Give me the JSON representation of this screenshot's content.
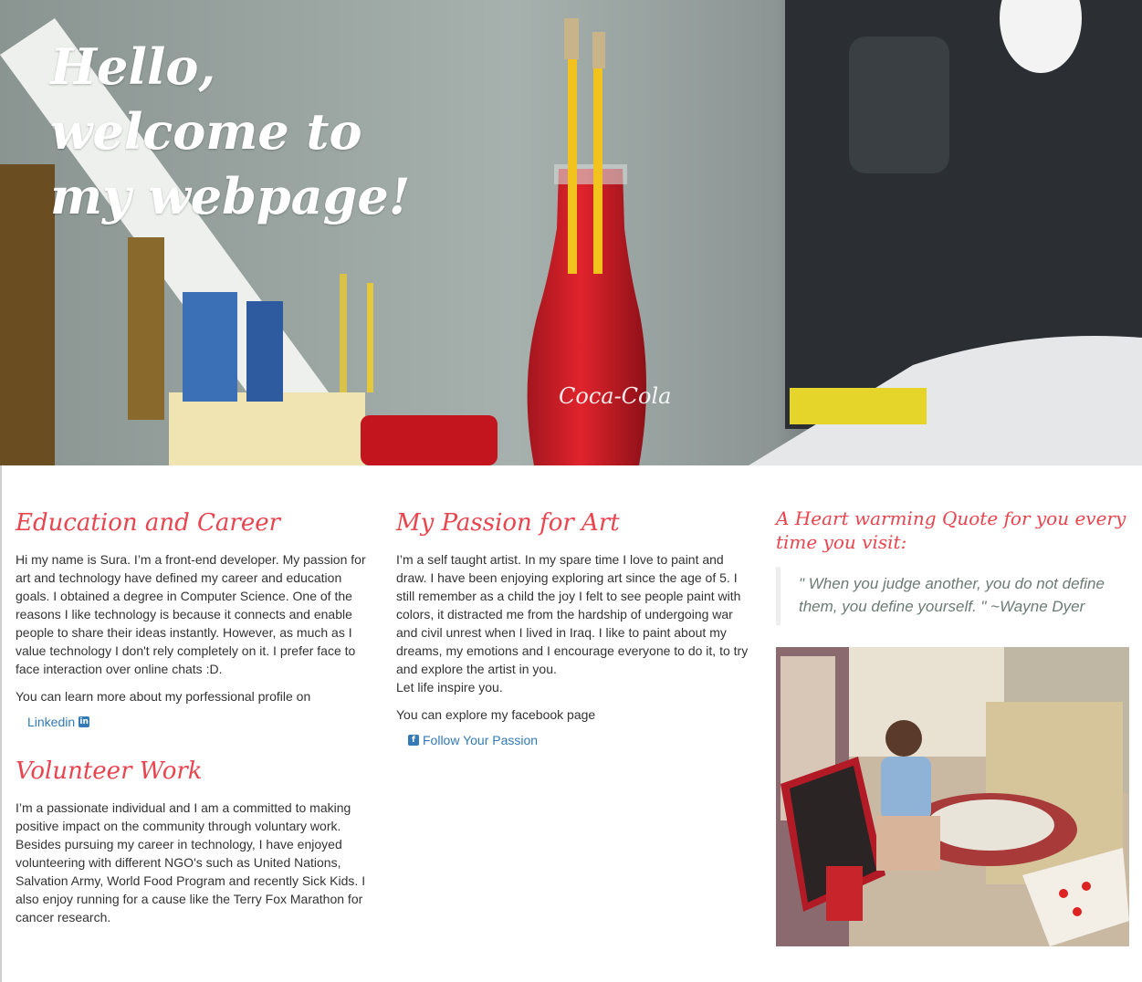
{
  "hero": {
    "title_lines": [
      "Hello,",
      "welcome to",
      "my webpage!"
    ]
  },
  "education": {
    "heading": "Education and Career",
    "paragraph": "Hi my name is Sura. I’m a front-end developer. My passion for art and technology have defined my career and education goals. I obtained a degree in Computer Science. One of the reasons I like technology is because it connects and enable people to share their ideas instantly. However, as much as I value technology I don't rely completely on it. I prefer face to face interaction over online chats :D.",
    "profile_text": "You can learn more about my porfessional profile on",
    "link_label": "Linkedin",
    "link_icon": "linkedin-icon"
  },
  "volunteer": {
    "heading": "Volunteer Work",
    "paragraph": "I’m a passionate individual and I am a committed to making positive impact on the community through voluntary work. Besides pursuing my career in technology, I have enjoyed volunteering with different NGO's such as United Nations, Salvation Army, World Food Program and recently Sick Kids. I also enjoy running for a cause like the Terry Fox Marathon for cancer research."
  },
  "art": {
    "heading": "My Passion for Art",
    "paragraph": "I’m a self taught artist. In my spare time I love to paint and draw. I have been enjoying exploring art since the age of 5. I still remember as a child the joy I felt to see people paint with colors, it distracted me from the hardship of undergoing war and civil unrest when I lived in Iraq. I like to paint about my dreams, my emotions and I encourage everyone to do it, to try and explore the artist in you.",
    "inspire": "Let life inspire you.",
    "facebook_text": "You can explore my facebook page",
    "link_label": "Follow Your Passion",
    "link_icon": "facebook-icon"
  },
  "quote": {
    "heading": "A Heart warming Quote for you every time you visit:",
    "text": "\" When you judge another, you do not define them, you define yourself. \" ~Wayne Dyer"
  },
  "colors": {
    "accent": "#e8454f",
    "link": "#337ab7",
    "quote_text": "#6b7b73",
    "body_text": "#333333"
  }
}
